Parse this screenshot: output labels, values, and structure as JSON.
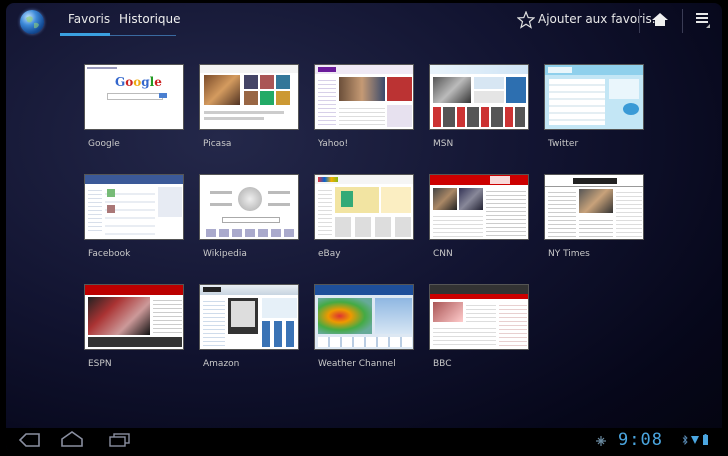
{
  "tabs": {
    "favoris": "Favoris",
    "historique": "Historique"
  },
  "actions": {
    "add_bookmark": "Ajouter aux favoris..."
  },
  "bookmarks": [
    {
      "label": "Google"
    },
    {
      "label": "Picasa"
    },
    {
      "label": "Yahoo!"
    },
    {
      "label": "MSN"
    },
    {
      "label": "Twitter"
    },
    {
      "label": "Facebook"
    },
    {
      "label": "Wikipedia"
    },
    {
      "label": "eBay"
    },
    {
      "label": "CNN"
    },
    {
      "label": "NY Times"
    },
    {
      "label": "ESPN"
    },
    {
      "label": "Amazon"
    },
    {
      "label": "Weather Channel"
    },
    {
      "label": "BBC"
    }
  ],
  "thumbnails": {
    "google_logo": "Google"
  },
  "status_bar": {
    "clock": "9:08"
  },
  "colors": {
    "accent": "#3aa0e0",
    "clock": "#4ba6e0",
    "background": "#121431"
  }
}
